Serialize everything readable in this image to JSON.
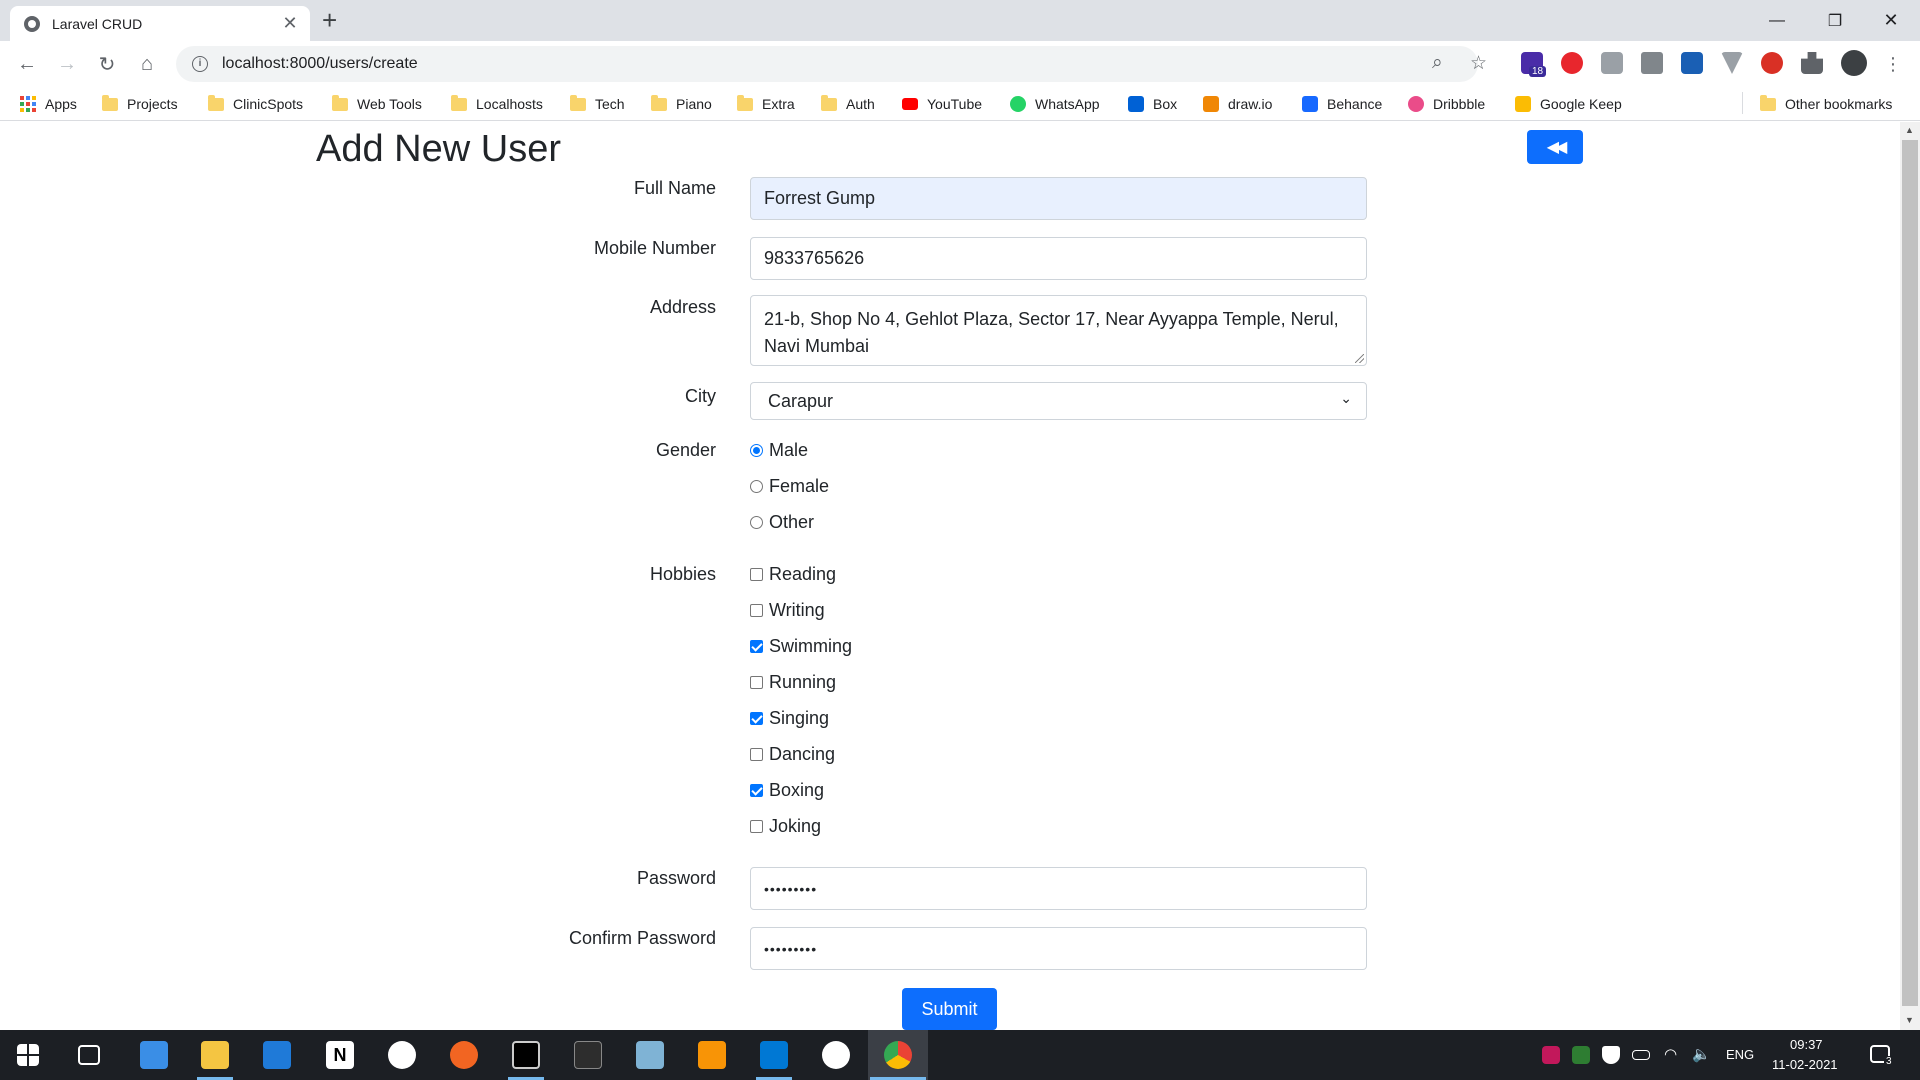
{
  "browser": {
    "tab_title": "Laravel CRUD",
    "tab_close": "✕",
    "new_tab": "+",
    "url": "localhost:8000/users/create",
    "badge_count": "18"
  },
  "bookmarks": [
    {
      "label": "Apps",
      "kind": "apps-icon"
    },
    {
      "label": "Projects",
      "kind": "folder-icon"
    },
    {
      "label": "ClinicSpots",
      "kind": "folder-icon"
    },
    {
      "label": "Web Tools",
      "kind": "folder-icon"
    },
    {
      "label": "Localhosts",
      "kind": "folder-icon"
    },
    {
      "label": "Tech",
      "kind": "folder-icon"
    },
    {
      "label": "Piano",
      "kind": "folder-icon"
    },
    {
      "label": "Extra",
      "kind": "folder-icon"
    },
    {
      "label": "Auth",
      "kind": "folder-icon"
    },
    {
      "label": "YouTube",
      "kind": "youtube-icon"
    },
    {
      "label": "WhatsApp",
      "kind": "whatsapp-icon"
    },
    {
      "label": "Box",
      "kind": "box-icon"
    },
    {
      "label": "draw.io",
      "kind": "drawio-icon"
    },
    {
      "label": "Behance",
      "kind": "behance-icon"
    },
    {
      "label": "Dribbble",
      "kind": "dribbble-icon"
    },
    {
      "label": "Google Keep",
      "kind": "keep-icon"
    },
    {
      "label": "Other bookmarks",
      "kind": "folder-icon"
    }
  ],
  "page": {
    "heading": "Add New User",
    "back_icon": "◀◀",
    "fields": {
      "full_name": {
        "label": "Full Name",
        "value": "Forrest Gump"
      },
      "mobile": {
        "label": "Mobile Number",
        "value": "9833765626"
      },
      "address": {
        "label": "Address",
        "value": "21-b, Shop No 4, Gehlot Plaza, Sector 17, Near Ayyappa Temple, Nerul, Navi Mumbai"
      },
      "city": {
        "label": "City",
        "value": "Carapur"
      },
      "password": {
        "label": "Password",
        "value": "•••••••••"
      },
      "confirm_password": {
        "label": "Confirm Password",
        "value": "•••••••••"
      }
    },
    "gender": {
      "label": "Gender",
      "options": [
        {
          "label": "Male",
          "checked": true
        },
        {
          "label": "Female",
          "checked": false
        },
        {
          "label": "Other",
          "checked": false
        }
      ]
    },
    "hobbies": {
      "label": "Hobbies",
      "options": [
        {
          "label": "Reading",
          "checked": false
        },
        {
          "label": "Writing",
          "checked": false
        },
        {
          "label": "Swimming",
          "checked": true
        },
        {
          "label": "Running",
          "checked": false
        },
        {
          "label": "Singing",
          "checked": true
        },
        {
          "label": "Dancing",
          "checked": false
        },
        {
          "label": "Boxing",
          "checked": true
        },
        {
          "label": "Joking",
          "checked": false
        }
      ]
    },
    "submit_label": "Submit"
  },
  "taskbar": {
    "language": "ENG",
    "time": "09:37",
    "date": "11-02-2021",
    "notifications": "3"
  },
  "colors": {
    "primary": "#0d6efd",
    "autofill": "#e8f0fe",
    "check": "#0075ff"
  }
}
